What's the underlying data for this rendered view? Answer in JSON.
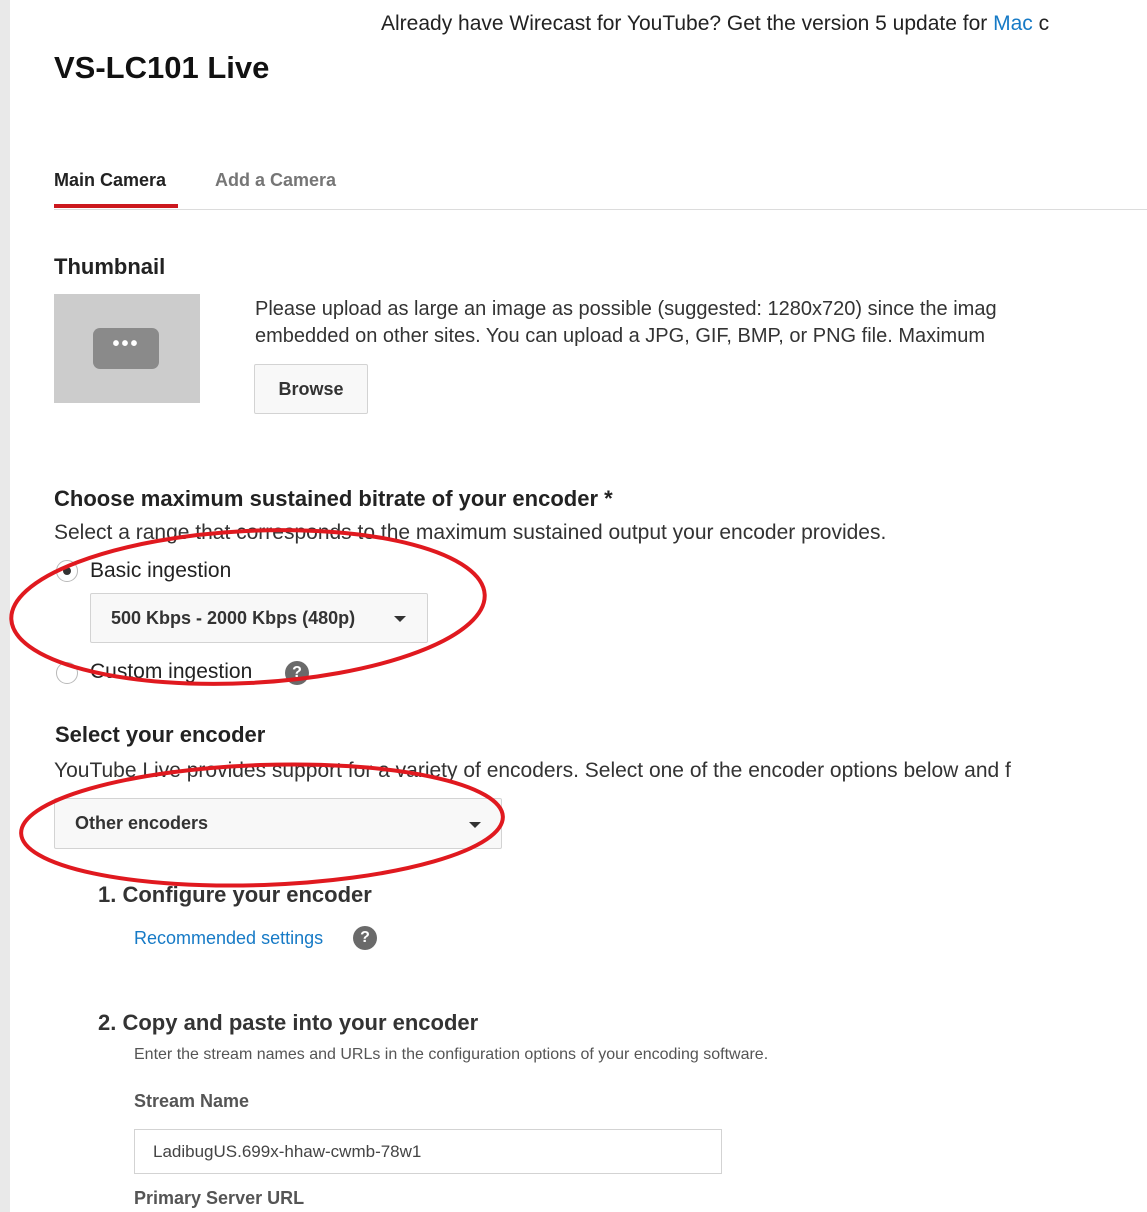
{
  "promo": {
    "text": "Already have Wirecast for YouTube? Get the version 5 update for",
    "link_mac": "Mac",
    "trailing": "c"
  },
  "page": {
    "title": "VS-LC101 Live"
  },
  "tabs": [
    {
      "label": "Main Camera",
      "active": true
    },
    {
      "label": "Add a Camera",
      "active": false
    }
  ],
  "thumbnail": {
    "heading": "Thumbnail",
    "placeholder_glyph": "•••",
    "description_line1": "Please upload as large an image as possible (suggested: 1280x720) since the imag",
    "description_line2": "embedded on other sites. You can upload a JPG, GIF, BMP, or PNG file. Maximum",
    "browse_label": "Browse"
  },
  "bitrate": {
    "heading": "Choose maximum sustained bitrate of your encoder *",
    "description": "Select a range that corresponds to the maximum sustained output your encoder provides.",
    "options": [
      {
        "label": "Basic ingestion",
        "selected": true
      },
      {
        "label": "Custom ingestion",
        "selected": false
      }
    ],
    "range_selected": "500 Kbps - 2000 Kbps (480p)",
    "help_glyph": "?"
  },
  "encoder": {
    "heading": "Select your encoder",
    "description": "YouTube Live provides support for a variety of encoders. Select one of the encoder options below and f",
    "selected": "Other encoders",
    "steps": [
      {
        "number": "1.",
        "title": "Configure your encoder",
        "link": "Recommended settings"
      },
      {
        "number": "2.",
        "title": "Copy and paste into your encoder",
        "description": "Enter the stream names and URLs in the configuration options of your encoding software."
      }
    ],
    "stream_name_label": "Stream Name",
    "stream_name_value": "LadibugUS.699x-hhaw-cwmb-78w1",
    "primary_server_label": "Primary Server URL"
  },
  "annotations": {
    "color": "#e0191f"
  },
  "colors": {
    "accent_red": "#cc181e",
    "link_blue": "#167ac6"
  }
}
